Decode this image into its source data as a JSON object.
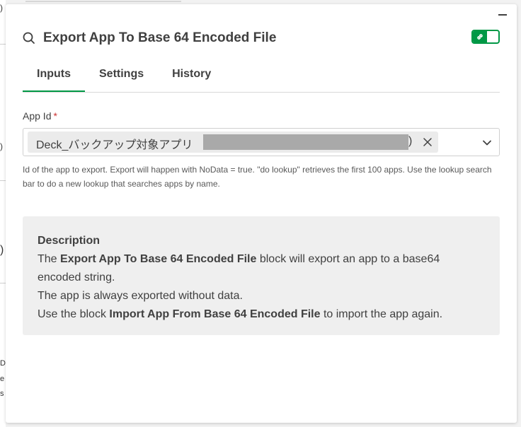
{
  "background": {
    "left_glyphs": [
      ")",
      ")",
      ")",
      "D",
      "e",
      "s"
    ]
  },
  "header": {
    "title": "Export App To Base 64 Encoded File"
  },
  "tabs": [
    {
      "label": "Inputs",
      "active": true
    },
    {
      "label": "Settings",
      "active": false
    },
    {
      "label": "History",
      "active": false
    }
  ],
  "field": {
    "label": "App Id",
    "required_mark": "*",
    "selected_value": "Deck_バックアップ対象アプリ",
    "selected_suffix": ")",
    "helper": "Id of the app to export. Export will happen with NoData = true. \"do lookup\" retrieves the first 100 apps. Use the lookup search bar to do a new lookup that searches apps by name."
  },
  "description": {
    "heading": "Description",
    "line1_pre": "The ",
    "line1_bold": "Export App To Base 64 Encoded File",
    "line1_post": " block will export an app to a base64 encoded string.",
    "line2": "The app is always exported without data.",
    "line3_pre": "Use the block ",
    "line3_bold": "Import App From Base 64 Encoded File",
    "line3_post": " to import the app again."
  },
  "colors": {
    "accent": "#009845",
    "required": "#cc3333",
    "description_bg": "#efefef"
  },
  "icons": {
    "header": "search-icon",
    "toggle": "link-icon",
    "clear": "close-icon",
    "dropdown": "chevron-down-icon",
    "minimize": "minimize-icon"
  }
}
